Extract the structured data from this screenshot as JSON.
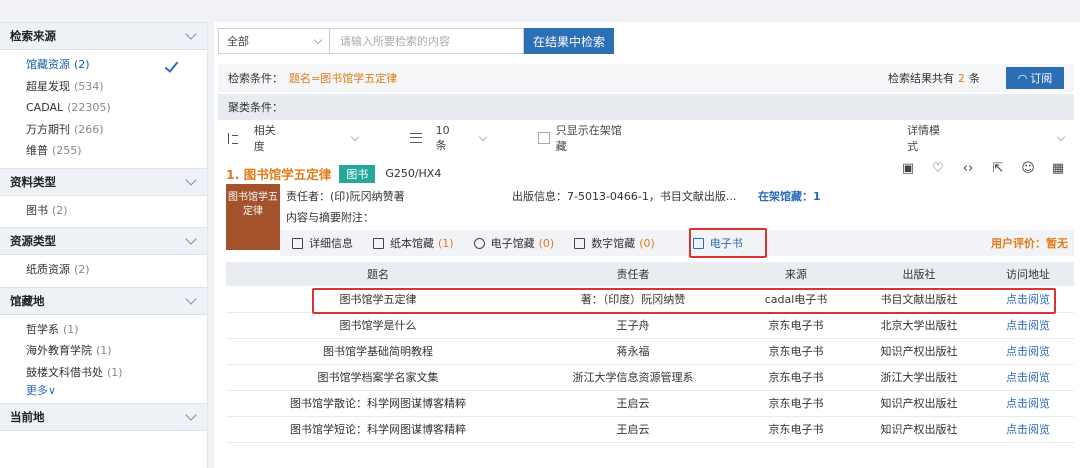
{
  "sidebar": {
    "sections": [
      {
        "title": "检索来源",
        "items": [
          {
            "label": "馆藏资源",
            "count": "(2)",
            "active": true
          },
          {
            "label": "超星发现",
            "count": "(534)"
          },
          {
            "label": "CADAL",
            "count": "(22305)"
          },
          {
            "label": "万方期刊",
            "count": "(266)"
          },
          {
            "label": "维普",
            "count": "(255)"
          }
        ]
      },
      {
        "title": "资料类型",
        "items": [
          {
            "label": "图书",
            "count": "(2)"
          }
        ]
      },
      {
        "title": "资源类型",
        "items": [
          {
            "label": "纸质资源",
            "count": "(2)"
          }
        ]
      },
      {
        "title": "馆藏地",
        "items": [
          {
            "label": "哲学系",
            "count": "(1)"
          },
          {
            "label": "海外教育学院",
            "count": "(1)"
          },
          {
            "label": "鼓楼文科借书处",
            "count": "(1)"
          }
        ],
        "more": "更多∨"
      },
      {
        "title": "当前地",
        "items": []
      }
    ]
  },
  "search": {
    "scope": "全部",
    "placeholder": "请输入所要检索的内容",
    "button": "在结果中检索"
  },
  "conditions": {
    "label": "检索条件：",
    "value": "题名=图书馆学五定律",
    "total_label": "检索结果共有",
    "total": "2",
    "unit": "条",
    "subscribe": "订阅"
  },
  "cluster": {
    "label": "聚类条件："
  },
  "sort": {
    "relevance": "相关度",
    "page_size": "10条",
    "only_available": "只显示在架馆藏",
    "mode": "详情模式"
  },
  "record": {
    "title": "1. 图书馆学五定律",
    "type_tag": "图书",
    "call_no": "G250/HX4",
    "cover_text": "图书馆学五定律",
    "author": "责任者：(印)阮冈纳赞著",
    "publish": "出版信息：7-5013-0466-1，书目文献出版...",
    "shelf": "在架馆藏：1",
    "abstract": "内容与摘要附注：",
    "tabs": [
      {
        "icon": "detail-icon",
        "label": "详细信息",
        "count": ""
      },
      {
        "icon": "paper-icon",
        "label": "纸本馆藏",
        "count": "(1)"
      },
      {
        "icon": "e-icon",
        "label": "电子馆藏",
        "count": "(0)"
      },
      {
        "icon": "digital-icon",
        "label": "数字馆藏",
        "count": "(0)"
      },
      {
        "icon": "ebook-icon",
        "label": "电子书",
        "count": ""
      }
    ],
    "rating": "用户评价：暂无"
  },
  "table": {
    "headers": [
      "题名",
      "责任者",
      "来源",
      "出版社",
      "访问地址"
    ],
    "rows": [
      [
        "图书馆学五定律",
        "著：（印度）阮冈纳赞",
        "cadal电子书",
        "书目文献出版社",
        "点击阅览"
      ],
      [
        "图书馆学是什么",
        "王子舟",
        "京东电子书",
        "北京大学出版社",
        "点击阅览"
      ],
      [
        "图书馆学基础简明教程",
        "蒋永福",
        "京东电子书",
        "知识产权出版社",
        "点击阅览"
      ],
      [
        "图书馆学档案学名家文集",
        "浙江大学信息资源管理系",
        "京东电子书",
        "浙江大学出版社",
        "点击阅览"
      ],
      [
        "图书馆学散论：科学网图谋博客精粹",
        "王启云",
        "京东电子书",
        "知识产权出版社",
        "点击阅览"
      ],
      [
        "图书馆学短论：科学网图谋博客精粹",
        "王启云",
        "京东电子书",
        "知识产权出版社",
        "点击阅览"
      ]
    ]
  },
  "colors": {
    "accent": "#2d6fb6",
    "highlight": "#e07b1a",
    "tag": "#23a89b",
    "marker": "#d83434"
  }
}
